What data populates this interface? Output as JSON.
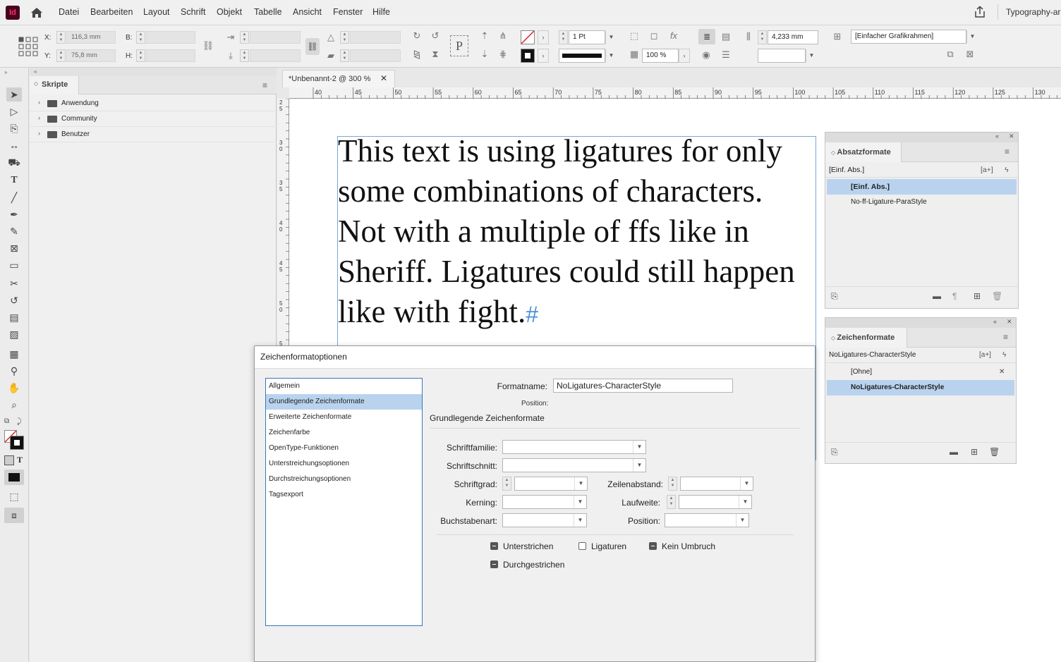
{
  "app": {
    "logo": "Id",
    "home_icon": "home-icon",
    "share_icon": "share-icon",
    "workspace": "Typography-ar"
  },
  "menu": [
    "Datei",
    "Bearbeiten",
    "Layout",
    "Schrift",
    "Objekt",
    "Tabelle",
    "Ansicht",
    "Fenster",
    "Hilfe"
  ],
  "control": {
    "x_label": "X:",
    "x_value": "116,3 mm",
    "y_label": "Y:",
    "y_value": "75,8 mm",
    "w_label": "B:",
    "h_label": "H:",
    "stroke_weight": "1 Pt",
    "opacity": "100 %",
    "gutter": "4,233 mm",
    "frame_style": "[Einfacher Grafikrahmen]"
  },
  "scripts": {
    "title": "Skripte",
    "items": [
      "Anwendung",
      "Community",
      "Benutzer"
    ]
  },
  "document": {
    "tab_title": "*Unbenannt-2 @ 300 %",
    "ruler_h": [
      "40",
      "45",
      "50",
      "55",
      "60",
      "65",
      "70",
      "75",
      "80",
      "85",
      "90",
      "95",
      "100",
      "105",
      "110",
      "115",
      "120",
      "125",
      "130"
    ],
    "ruler_v": [
      "2",
      "5",
      "3",
      "0",
      "3",
      "5",
      "4",
      "0",
      "4",
      "5",
      "5",
      "0",
      "5"
    ],
    "text_lines": [
      "This text is using ligatures for only",
      "some combinations of characters.",
      "Not with a multiple of ffs like in",
      "Sheriff. Ligatures could still happen",
      "like with fight."
    ],
    "end_marker": "#"
  },
  "para_styles": {
    "title": "Absatzformate",
    "current": "[Einf. Abs.]",
    "new_icon_text": "[a+]",
    "items": [
      "[Einf. Abs.]",
      "No-ff-Ligature-ParaStyle"
    ],
    "selected_index": 0
  },
  "char_styles": {
    "title": "Zeichenformate",
    "current": "NoLigatures-CharacterStyle",
    "new_icon_text": "[a+]",
    "items": [
      "[Ohne]",
      "NoLigatures-CharacterStyle"
    ],
    "selected_index": 1
  },
  "dialog": {
    "title": "Zeichenformatoptionen",
    "categories": [
      "Allgemein",
      "Grundlegende Zeichenformate",
      "Erweiterte Zeichenformate",
      "Zeichenfarbe",
      "OpenType-Funktionen",
      "Unterstreichungsoptionen",
      "Durchstreichungsoptionen",
      "Tagsexport"
    ],
    "selected_category": 1,
    "style_name_label": "Formatname:",
    "style_name_value": "NoLigatures-CharacterStyle",
    "position_label": "Position:",
    "section_title": "Grundlegende Zeichenformate",
    "fields": {
      "font_family": "Schriftfamilie:",
      "font_style": "Schriftschnitt:",
      "size": "Schriftgrad:",
      "leading": "Zeilenabstand:",
      "kerning": "Kerning:",
      "tracking": "Laufweite:",
      "case": "Buchstabenart:",
      "position": "Position:"
    },
    "checkboxes": {
      "underline": {
        "label": "Unterstrichen",
        "state": "indeterminate"
      },
      "ligatures": {
        "label": "Ligaturen",
        "state": "unchecked"
      },
      "no_break": {
        "label": "Kein Umbruch",
        "state": "indeterminate"
      },
      "strikethrough": {
        "label": "Durchgestrichen",
        "state": "indeterminate"
      }
    }
  },
  "colors": {
    "accent": "#3a74bd",
    "selection": "#b9d3ef",
    "frame": "#7aa7d6",
    "hidden_char": "#4a90d9"
  }
}
